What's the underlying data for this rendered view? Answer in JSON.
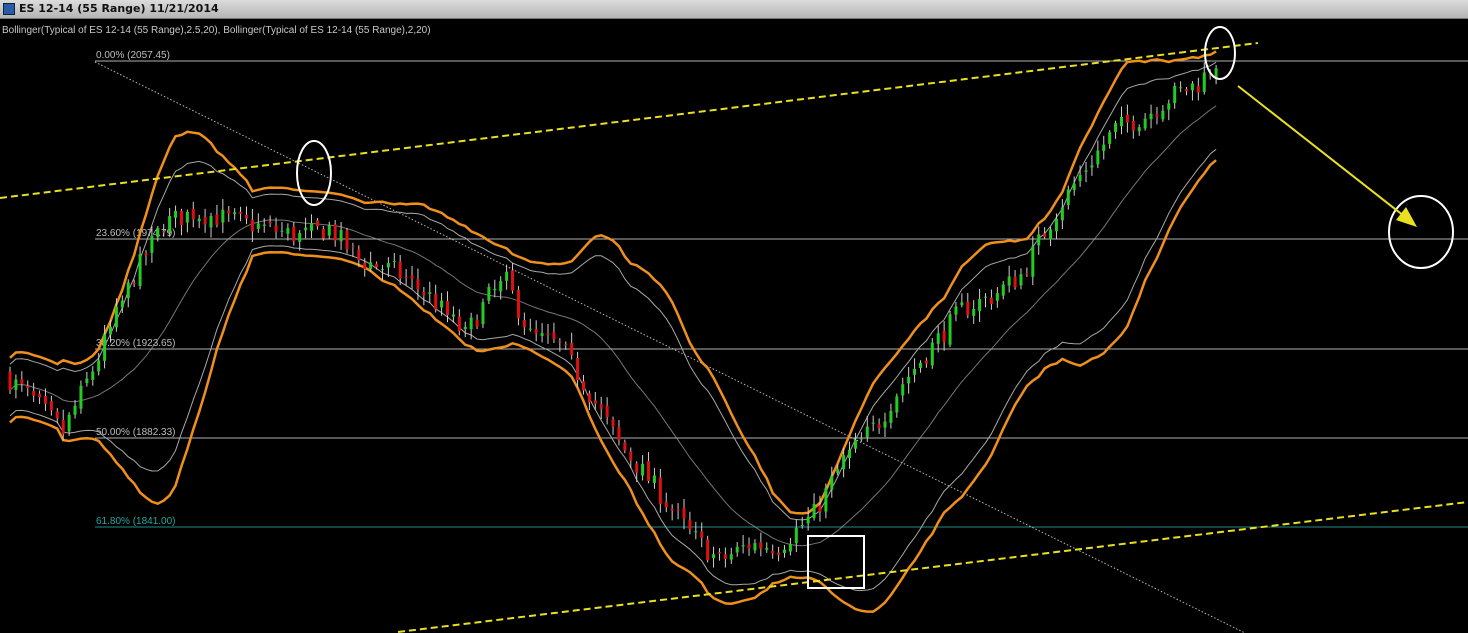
{
  "window": {
    "title": "ES 12-14 (55 Range)  11/21/2014"
  },
  "indicator_label": "Bollinger(Typical of ES 12-14 (55 Range),2.5,20), Bollinger(Typical of ES 12-14 (55 Range),2,20)",
  "colors": {
    "background": "#000000",
    "up_candle": "#22cc22",
    "down_candle": "#dd1111",
    "outer_band": "#f0901c",
    "inner_band": "#a8a8a8",
    "trendline": "#e8e020",
    "fib_line": "#cfcfcf",
    "fib_line_618": "#2aa6a0",
    "arrow": "#e8e020"
  },
  "chart_data": {
    "type": "candlestick",
    "symbol": "ES 12-14",
    "bar_type": "55 Range",
    "ylim": [
      1815,
      2072
    ],
    "fibonacci": [
      {
        "label": "0.00% (2057.45)",
        "level": 0.0,
        "price": 2057.45
      },
      {
        "label": "23.60% (1974.79)",
        "level": 23.6,
        "price": 1974.79
      },
      {
        "label": "38.20% (1923.65)",
        "level": 38.2,
        "price": 1923.65
      },
      {
        "label": "50.00% (1882.33)",
        "level": 50.0,
        "price": 1882.33
      },
      {
        "label": "61.80% (1841.00)",
        "level": 61.8,
        "price": 1841.0
      }
    ],
    "price_path": [
      [
        0,
        1912
      ],
      [
        5,
        1900
      ],
      [
        10,
        1885
      ],
      [
        16,
        1920
      ],
      [
        22,
        1958
      ],
      [
        27,
        1982
      ],
      [
        32,
        1987
      ],
      [
        38,
        1984
      ],
      [
        44,
        1980
      ],
      [
        50,
        1976
      ],
      [
        55,
        1980
      ],
      [
        60,
        1965
      ],
      [
        66,
        1960
      ],
      [
        72,
        1948
      ],
      [
        78,
        1930
      ],
      [
        82,
        1948
      ],
      [
        85,
        1955
      ],
      [
        89,
        1930
      ],
      [
        94,
        1925
      ],
      [
        98,
        1908
      ],
      [
        104,
        1880
      ],
      [
        110,
        1860
      ],
      [
        116,
        1838
      ],
      [
        121,
        1825
      ],
      [
        126,
        1833
      ],
      [
        131,
        1832
      ],
      [
        137,
        1847
      ],
      [
        142,
        1872
      ],
      [
        148,
        1890
      ],
      [
        152,
        1908
      ],
      [
        157,
        1925
      ],
      [
        162,
        1942
      ],
      [
        167,
        1948
      ],
      [
        172,
        1958
      ],
      [
        178,
        1988
      ],
      [
        183,
        2008
      ],
      [
        188,
        2026
      ],
      [
        193,
        2032
      ],
      [
        198,
        2042
      ],
      [
        202,
        2047
      ],
      [
        205,
        2057
      ]
    ],
    "bar_count": 205
  }
}
